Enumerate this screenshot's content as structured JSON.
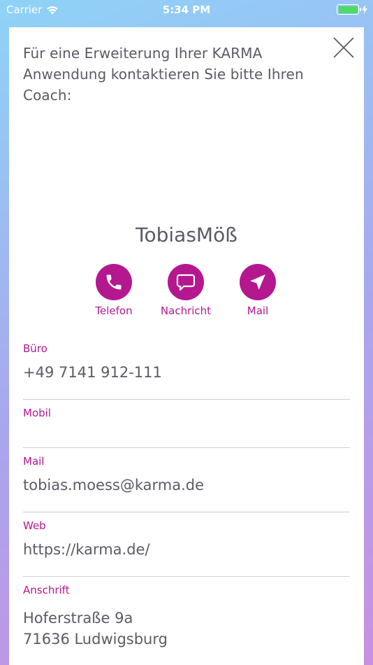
{
  "status_bar": {
    "carrier": "Carrier",
    "time": "5:34 PM",
    "battery_color": "#4cd964"
  },
  "intro_text": "Für eine Erweiterung Ihrer KARMA Anwendung kontaktieren Sie bitte Ihren Coach:",
  "coach": {
    "name": "TobiasMöß"
  },
  "actions": [
    {
      "label": "Telefon",
      "icon": "phone-icon"
    },
    {
      "label": "Nachricht",
      "icon": "chat-bubble-icon"
    },
    {
      "label": "Mail",
      "icon": "send-icon"
    }
  ],
  "fields": {
    "office": {
      "label": "Büro",
      "value": "+49 7141 912-111"
    },
    "mobile": {
      "label": "Mobil",
      "value": ""
    },
    "mail": {
      "label": "Mail",
      "value": "tobias.moess@karma.de"
    },
    "web": {
      "label": "Web",
      "value": "https://karma.de/"
    },
    "address": {
      "label": "Anschrift",
      "line1": "Hoferstraße 9a",
      "line2": "71636 Ludwigsburg"
    }
  },
  "colors": {
    "accent": "#b5178f",
    "text": "#5b5b66",
    "divider": "#cfcfd6"
  }
}
